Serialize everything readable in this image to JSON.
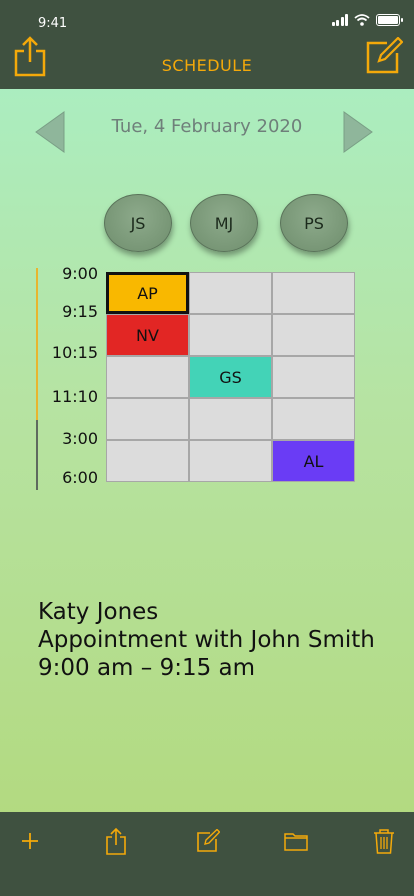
{
  "status": {
    "time": "9:41"
  },
  "header": {
    "title": "SCHEDULE",
    "share_icon": "share-icon",
    "compose_icon": "compose-icon"
  },
  "date_nav": {
    "date": "Tue, 4 February 2020",
    "prev_icon": "chevron-left-icon",
    "next_icon": "chevron-right-icon"
  },
  "people": [
    "JS",
    "MJ",
    "PS"
  ],
  "times": [
    "9:00",
    "9:15",
    "10:15",
    "11:10",
    "3:00",
    "6:00"
  ],
  "grid": {
    "rows": [
      [
        {
          "label": "AP",
          "color": "#f9b800",
          "selected": true
        },
        {
          "label": "",
          "color": "#dcdcdc"
        },
        {
          "label": "",
          "color": "#dcdcdc"
        }
      ],
      [
        {
          "label": "NV",
          "color": "#e22624"
        },
        {
          "label": "",
          "color": "#dcdcdc"
        },
        {
          "label": "",
          "color": "#dcdcdc"
        }
      ],
      [
        {
          "label": "",
          "color": "#dcdcdc"
        },
        {
          "label": "GS",
          "color": "#43d3b7"
        },
        {
          "label": "",
          "color": "#dcdcdc"
        }
      ],
      [
        {
          "label": "",
          "color": "#dcdcdc"
        },
        {
          "label": "",
          "color": "#dcdcdc"
        },
        {
          "label": "",
          "color": "#dcdcdc"
        }
      ],
      [
        {
          "label": "",
          "color": "#dcdcdc"
        },
        {
          "label": "",
          "color": "#dcdcdc"
        },
        {
          "label": "AL",
          "color": "#6a3cf5"
        }
      ]
    ]
  },
  "details": {
    "name": "Katy Jones",
    "title": "Appointment with John Smith",
    "time": "9:00 am – 9:15 am"
  },
  "toolbar": {
    "icons": [
      "plus-icon",
      "share-icon",
      "compose-icon",
      "folder-icon",
      "trash-icon"
    ]
  },
  "colors": {
    "accent": "#f4a90a",
    "bar": "#3f5140"
  }
}
